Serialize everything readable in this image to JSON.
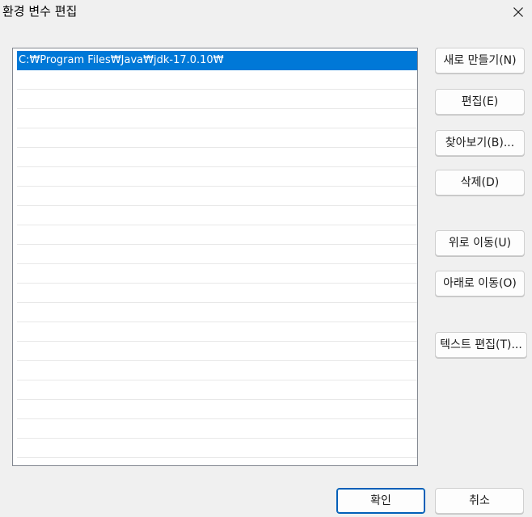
{
  "window": {
    "title": "환경 변수 편집",
    "close_icon": "close-icon"
  },
  "path_list": {
    "entries": [
      "C:₩Program Files₩Java₩jdk-17.0.10₩"
    ],
    "selected_index": 0
  },
  "side_buttons": {
    "new": "새로 만들기(N)",
    "edit": "편집(E)",
    "browse": "찾아보기(B)...",
    "delete": "삭제(D)",
    "move_up": "위로 이동(U)",
    "move_down": "아래로 이동(O)",
    "edit_text": "텍스트 편집(T)..."
  },
  "footer": {
    "ok": "확인",
    "cancel": "취소"
  },
  "colors": {
    "selection": "#0078d7",
    "dialog_bg": "#f0f0f0",
    "default_button_border": "#005fb8"
  }
}
